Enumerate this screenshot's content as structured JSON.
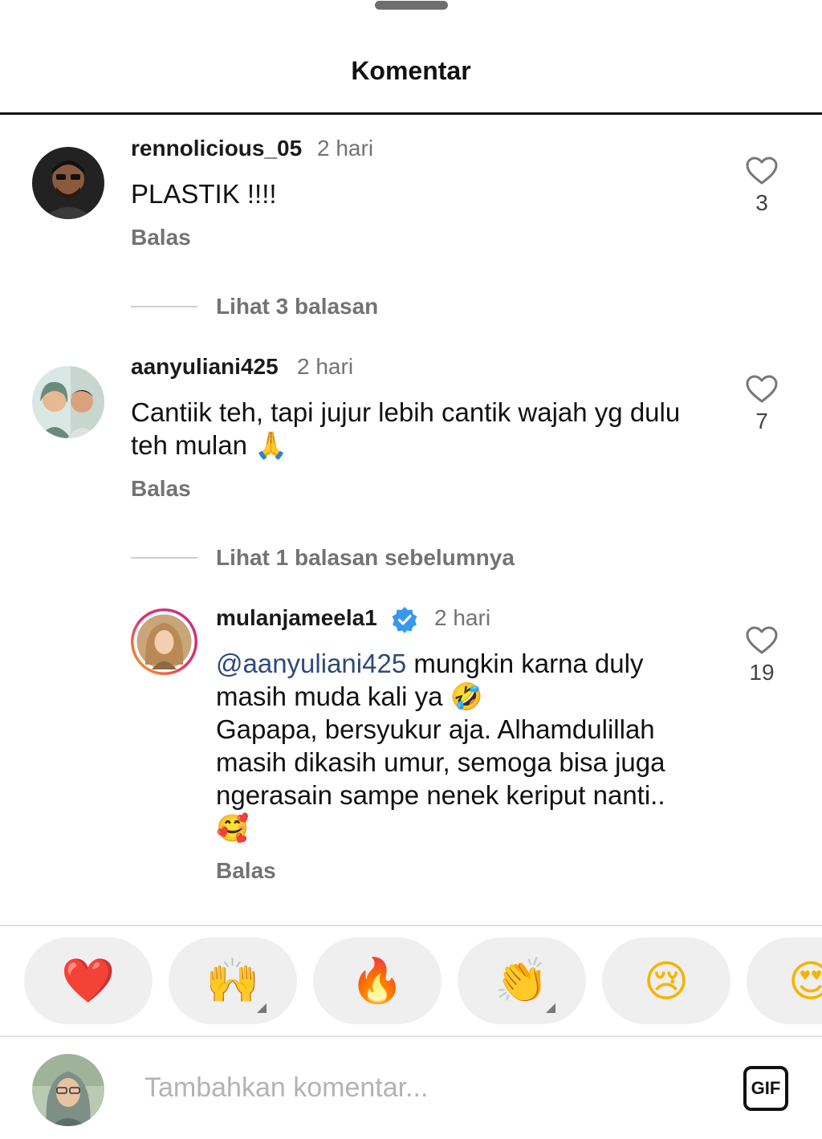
{
  "header": {
    "title": "Komentar"
  },
  "comments": [
    {
      "username": "rennolicious_05",
      "time": "2 hari",
      "text": "PLASTIK !!!!",
      "reply_label": "Balas",
      "likes": "3",
      "view_replies": "Lihat 3 balasan"
    },
    {
      "username": "aanyuliani425",
      "time": "2 hari",
      "text_line1": "Cantiik teh, tapi jujur lebih cantik wajah yg dulu",
      "text_line2": "teh mulan",
      "emoji": "🙏",
      "reply_label": "Balas",
      "likes": "7",
      "view_replies": "Lihat 1 balasan sebelumnya"
    },
    {
      "username": "mulanjameela1",
      "verified": true,
      "time": "2 hari",
      "mention": "@aanyuliani425",
      "line1_rest": " mungkin karna duly",
      "line2": "masih muda kali ya",
      "line2_emoji": "🤣",
      "line3": "Gapapa, bersyukur aja. Alhamdulillah",
      "line4": "masih dikasih umur, semoga bisa juga",
      "line5": "ngerasain sampe nenek keriput nanti..",
      "line6_emoji": "🥰",
      "reply_label": "Balas",
      "likes": "19"
    }
  ],
  "reactions": [
    {
      "emoji": "❤️",
      "has_more": false
    },
    {
      "emoji": "🙌",
      "has_more": true
    },
    {
      "emoji": "🔥",
      "has_more": false
    },
    {
      "emoji": "👏",
      "has_more": true
    },
    {
      "emoji": "😢",
      "has_more": false
    },
    {
      "emoji": "😍",
      "has_more": false
    }
  ],
  "composer": {
    "placeholder": "Tambahkan komentar...",
    "gif_label": "GIF"
  },
  "colors": {
    "mention": "#2f4a7a",
    "muted": "#737373",
    "verified": "#3897f0"
  }
}
